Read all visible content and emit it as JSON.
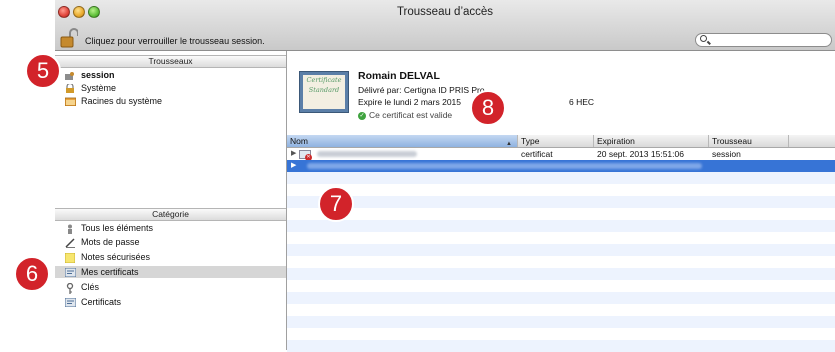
{
  "window": {
    "title": "Trousseau d’accès"
  },
  "lock_bar": {
    "text": "Cliquez pour verrouiller le trousseau session."
  },
  "search": {
    "placeholder": "",
    "icon": "search-icon"
  },
  "sidebar": {
    "keychains_header": "Trousseaux",
    "keychains": [
      {
        "label": "session",
        "icon": "keychain-icon",
        "bold": true
      },
      {
        "label": "Système",
        "icon": "lock-icon"
      },
      {
        "label": "Racines du système",
        "icon": "folder-icon"
      }
    ],
    "category_header": "Catégorie",
    "categories": [
      {
        "label": "Tous les éléments",
        "icon": "people-icon"
      },
      {
        "label": "Mots de passe",
        "icon": "key-pen-icon"
      },
      {
        "label": "Notes sécurisées",
        "icon": "note-icon"
      },
      {
        "label": "Mes certificats",
        "icon": "certificate-icon",
        "selected": true
      },
      {
        "label": "Clés",
        "icon": "key-icon"
      },
      {
        "label": "Certificats",
        "icon": "certificate-icon"
      }
    ]
  },
  "certificate": {
    "image_text_1": "Certificate",
    "image_text_2": "Standard",
    "name": "Romain DELVAL",
    "issued_by": "Délivré par: Certigna ID PRIS Pro",
    "expires": "Expire le lundi 2 mars 2015",
    "expires_tail": "6 HEC",
    "valid_text": "Ce certificat est valide"
  },
  "table": {
    "columns": [
      "Nom",
      "Type",
      "Expiration",
      "Trousseau"
    ],
    "rows": [
      {
        "type": "certificat",
        "expiration": "20 sept. 2013 15:51:06",
        "keychain": "session",
        "selected": false
      },
      {
        "type": "",
        "expiration": "",
        "keychain": "",
        "selected": true
      }
    ]
  },
  "badges": [
    "5",
    "6",
    "7",
    "8"
  ],
  "colors": {
    "selection": "#3774d6",
    "badge": "#d2232a",
    "stripe": "#edf3fe"
  }
}
